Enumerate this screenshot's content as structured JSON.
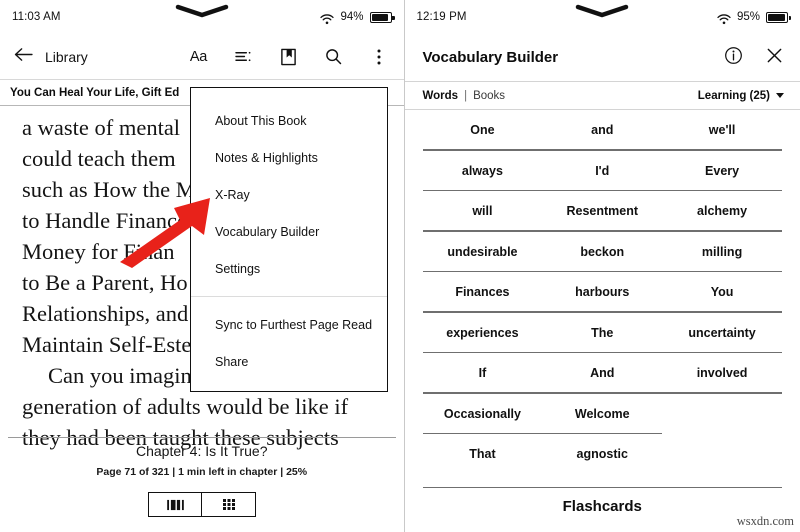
{
  "left_panel": {
    "status_bar": {
      "time": "11:03 AM",
      "battery_percent": "94%",
      "wifi_icon": "wifi-icon",
      "battery_icon": "battery-icon",
      "notch_icon": "chevron-down-notch-icon"
    },
    "toolbar": {
      "back_icon": "back-arrow-icon",
      "back_label": "Library",
      "icons": [
        {
          "name": "font-size-icon",
          "glyph": "Aa"
        },
        {
          "name": "table-of-contents-icon"
        },
        {
          "name": "bookmark-icon"
        },
        {
          "name": "search-icon"
        },
        {
          "name": "more-options-icon"
        }
      ]
    },
    "book_title": "You Can Heal Your Life, Gift Ed",
    "book_text": [
      "a waste of mental",
      "could teach them",
      "such as How the M",
      "to Handle Finance",
      "Money for Finan",
      "to Be a Parent, Ho",
      "Relationships, and",
      "Maintain Self-Este",
      "Can you imagin",
      "generation of adults would be like if",
      "they had been taught these subjects"
    ],
    "footer": {
      "chapter_title": "Chapter 4: Is It True?",
      "page_meta": "Page 71 of 321 | 1 min left in chapter | 25%",
      "view_toggle": [
        {
          "name": "page-view-icon"
        },
        {
          "name": "grid-view-icon"
        }
      ]
    },
    "menu": {
      "group_1": [
        "About This Book",
        "Notes & Highlights",
        "X-Ray",
        "Vocabulary Builder",
        "Settings"
      ],
      "group_2": [
        "Sync to Furthest Page Read",
        "Share"
      ]
    },
    "annotation": {
      "arrow_color": "#e8221a",
      "arrow_points_to": "Vocabulary Builder"
    }
  },
  "right_panel": {
    "status_bar": {
      "time": "12:19 PM",
      "battery_percent": "95%",
      "wifi_icon": "wifi-icon",
      "battery_icon": "battery-icon",
      "notch_icon": "chevron-down-notch-icon"
    },
    "header": {
      "title": "Vocabulary Builder",
      "info_icon": "info-icon",
      "close_icon": "close-icon"
    },
    "tabs": {
      "words_label": "Words",
      "separator": "|",
      "books_label": "Books",
      "filter_label": "Learning (25)",
      "filter_caret_icon": "chevron-down-icon"
    },
    "word_rows": [
      [
        "One",
        "and",
        "we'll"
      ],
      [
        "always",
        "I'd",
        "Every"
      ],
      [
        "will",
        "Resentment",
        "alchemy"
      ],
      [
        "undesirable",
        "beckon",
        "milling"
      ],
      [
        "Finances",
        "harbours",
        "You"
      ],
      [
        "experiences",
        "The",
        "uncertainty"
      ],
      [
        "If",
        "And",
        "involved"
      ],
      [
        "Occasionally",
        "Welcome",
        ""
      ],
      [
        "That",
        "agnostic",
        ""
      ]
    ],
    "flashcards_label": "Flashcards"
  },
  "watermark": "wsxdn.com"
}
